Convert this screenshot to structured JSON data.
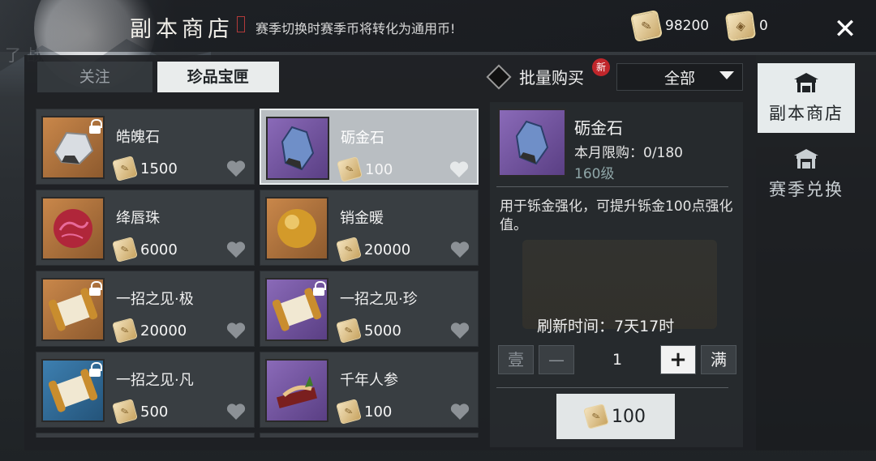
{
  "header": {
    "title": "副本商店",
    "subtitle": "赛季切换时赛季币将转化为通用币!",
    "currency": [
      {
        "icon": "season-coin-icon",
        "value": "98200"
      },
      {
        "icon": "badge-coin-icon",
        "value": "0"
      }
    ],
    "close_glyph": "✕"
  },
  "background": {
    "left_label": "了 战"
  },
  "tabs": [
    {
      "label": "关注",
      "active": false
    },
    {
      "label": "珍品宝匣",
      "active": true
    }
  ],
  "bulk_buy": {
    "label": "批量购买",
    "badge": "新"
  },
  "filter": {
    "selected": "全部"
  },
  "items": [
    {
      "name": "皓魄石",
      "price": "1500",
      "locked": true,
      "thumb": "orange"
    },
    {
      "name": "砺金石",
      "price": "100",
      "locked": false,
      "thumb": "purple",
      "selected": true
    },
    {
      "name": "绛唇珠",
      "price": "6000",
      "locked": false,
      "thumb": "orange"
    },
    {
      "name": "销金暖",
      "price": "20000",
      "locked": false,
      "thumb": "orange"
    },
    {
      "name": "一招之见·极",
      "price": "20000",
      "locked": true,
      "thumb": "orange"
    },
    {
      "name": "一招之见·珍",
      "price": "5000",
      "locked": true,
      "thumb": "purple"
    },
    {
      "name": "一招之见·凡",
      "price": "500",
      "locked": true,
      "thumb": "blue"
    },
    {
      "name": "千年人参",
      "price": "100",
      "locked": false,
      "thumb": "purple"
    }
  ],
  "detail": {
    "name": "砺金石",
    "limit": "本月限购：0/180",
    "level": "160级",
    "description": "用于铄金强化，可提升铄金100点强化值。",
    "refresh": "刷新时间：7天17时",
    "quantity": {
      "min_label": "壹",
      "dec_label": "—",
      "value": "1",
      "inc_label": "+",
      "max_label": "满"
    },
    "buy_price": "100"
  },
  "sidebar": [
    {
      "label": "副本商店",
      "active": true,
      "icon": "shop-icon"
    },
    {
      "label": "赛季兑换",
      "active": false,
      "icon": "exchange-icon"
    }
  ],
  "colors": {
    "accent": "#e9ecec",
    "new_badge": "#c0262b",
    "coin": "#e8d4a0"
  }
}
